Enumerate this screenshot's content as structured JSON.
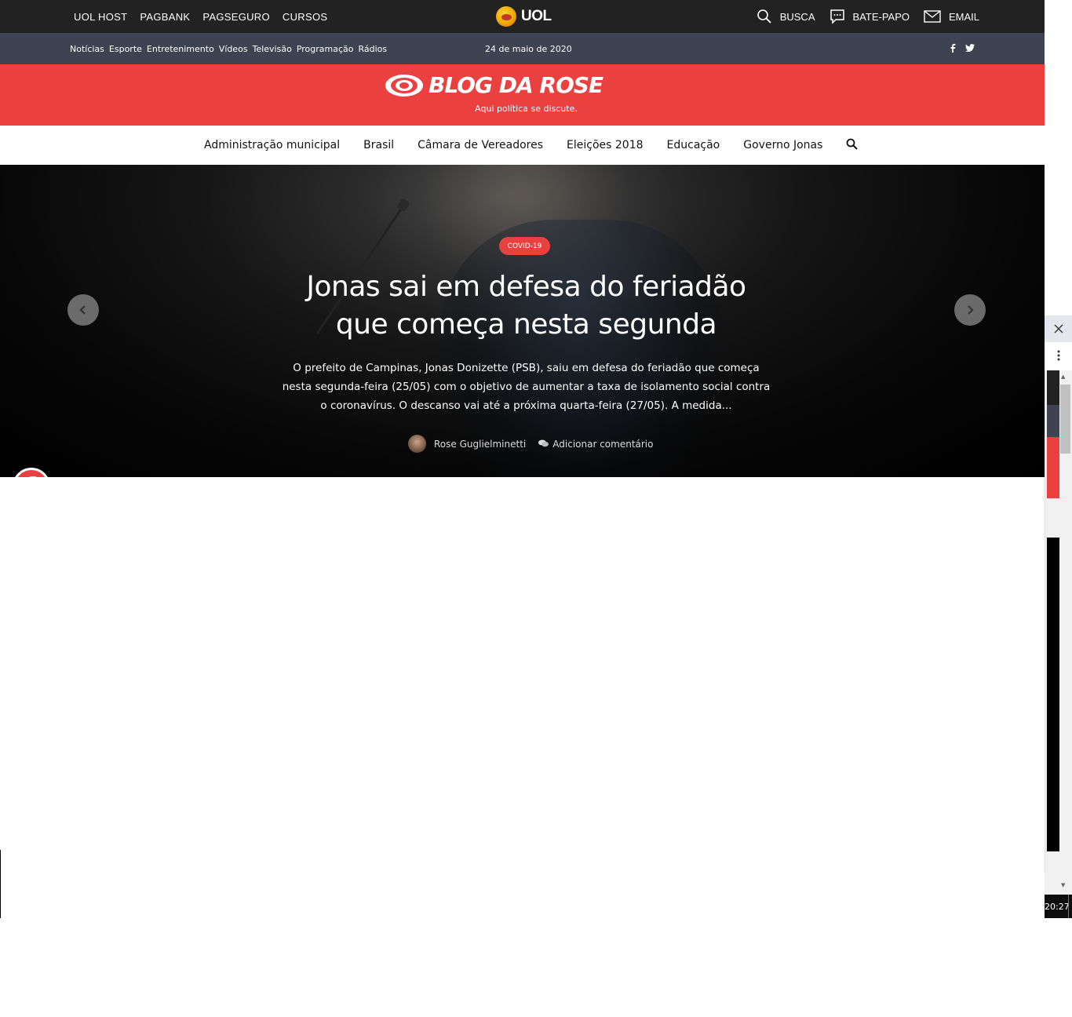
{
  "uol": {
    "links": [
      "UOL HOST",
      "PAGBANK",
      "PAGSEGURO",
      "CURSOS"
    ],
    "logo_text": "UOL",
    "busca": "BUSCA",
    "batepapo": "BATE-PAPO",
    "email": "EMAIL"
  },
  "subbar": {
    "nav": [
      "Notícias",
      "Esporte",
      "Entretenimento",
      "Vídeos",
      "Televisão",
      "Programação",
      "Rádios"
    ],
    "date": "24 de maio de 2020",
    "social": [
      "f",
      "twitter-icon"
    ]
  },
  "brand": {
    "title": "BLOG DA ROSE",
    "tagline": "Aqui política se discute."
  },
  "categories": [
    "Administração municipal",
    "Brasil",
    "Câmara de Vereadores",
    "Eleições 2018",
    "Educação",
    "Governo Jonas"
  ],
  "hero": {
    "badge": "COVID-19",
    "title_line1": "Jonas sai em defesa do feriadão",
    "title_line2": "que começa nesta segunda",
    "excerpt_line1": "O prefeito de Campinas, Jonas Donizette (PSB), saiu em defesa do feriadão que começa",
    "excerpt_line2": "nesta segunda-feira (25/05) com o objetivo de aumentar a taxa de isolamento social contra",
    "excerpt_line3": "o coronavírus. O descanso vai até a próxima quarta-feira (27/05). A medida...",
    "author": "Rose Guglielminetti",
    "comments": "Adicionar comentário"
  },
  "clock": "20:27",
  "colors": {
    "brand_red": "#ea4040",
    "uol_bar": "#222222",
    "sub_bar": "#3e4251"
  }
}
